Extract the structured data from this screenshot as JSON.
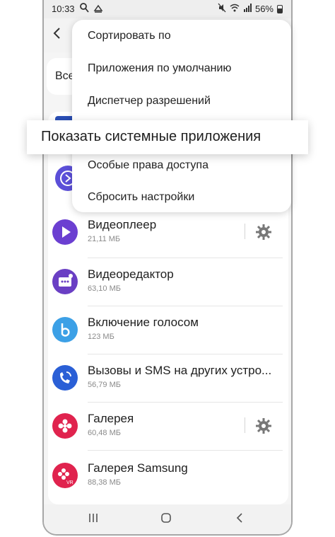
{
  "status_bar": {
    "time": "10:33",
    "left_icons": [
      "search-icon",
      "notification-icon"
    ],
    "right_icons": [
      "mute-icon",
      "wifi-icon",
      "signal-icon"
    ],
    "battery": "56%"
  },
  "header": {
    "back_icon": "back-arrow-icon"
  },
  "filter": {
    "label": "Все"
  },
  "menu": {
    "items": [
      "Сортировать по",
      "Приложения по умолчанию",
      "Диспетчер разрешений",
      "Показать системные приложения",
      "Особые права доступа",
      "Сбросить настройки"
    ]
  },
  "callout": {
    "label": "Показать системные приложения"
  },
  "apps": [
    {
      "name": "Видеоплеер",
      "size": "21,11 МБ",
      "icon": "video-player-icon",
      "color": "#6b3fd1",
      "settings": true
    },
    {
      "name": "Видеоредактор",
      "size": "63,10 МБ",
      "icon": "video-editor-icon",
      "color": "#6a3fc4",
      "settings": false
    },
    {
      "name": "Включение голосом",
      "size": "123 МБ",
      "icon": "bixby-icon",
      "color": "#3ca0e6",
      "settings": false
    },
    {
      "name": "Вызовы и SMS на других устро...",
      "size": "56,79 МБ",
      "icon": "call-sync-icon",
      "color": "#2a5fd6",
      "settings": false
    },
    {
      "name": "Галерея",
      "size": "60,48 МБ",
      "icon": "gallery-icon",
      "color": "#e0234e",
      "settings": true
    },
    {
      "name": "Галерея Samsung",
      "size": "88,38 МБ",
      "icon": "gallery-vr-icon",
      "color": "#e0234e",
      "settings": false
    }
  ],
  "nav_bar": {
    "recents_icon": "recents-icon",
    "home_icon": "home-icon",
    "back_icon": "back-icon"
  }
}
